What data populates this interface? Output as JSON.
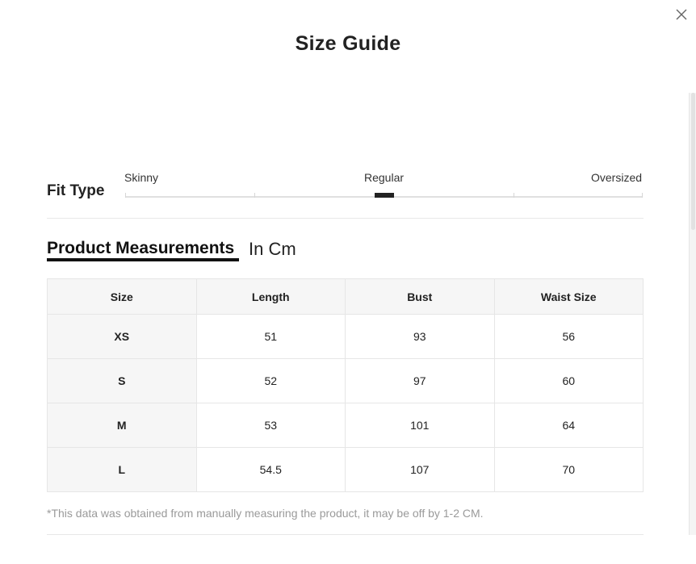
{
  "dialog": {
    "title": "Size Guide",
    "close_icon": "close-icon"
  },
  "fit_type": {
    "label": "Fit Type",
    "options": [
      "Skinny",
      "Regular",
      "Oversized"
    ],
    "selected": "Regular"
  },
  "measurements": {
    "tab_label": "Product Measurements",
    "unit": "In Cm",
    "headers": [
      "Size",
      "Length",
      "Bust",
      "Waist Size"
    ],
    "rows": [
      [
        "XS",
        "51",
        "93",
        "56"
      ],
      [
        "S",
        "52",
        "97",
        "60"
      ],
      [
        "M",
        "53",
        "101",
        "64"
      ],
      [
        "L",
        "54.5",
        "107",
        "70"
      ]
    ]
  },
  "note": "*This data was obtained from manually measuring the product, it may be off by 1-2 CM."
}
